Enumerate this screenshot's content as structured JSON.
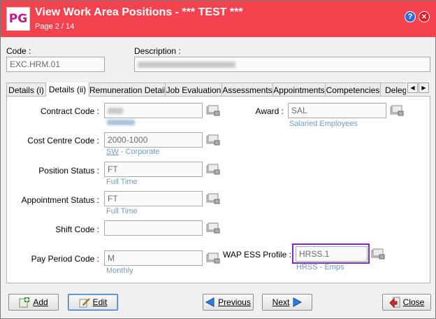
{
  "window": {
    "logo": "PG",
    "title": "View Work Area Positions - *** TEST ***",
    "subtitle": "Page 2 / 14",
    "help_glyph": "?",
    "close_glyph": "✕"
  },
  "header": {
    "code_label": "Code :",
    "code_value": "EXC.HRM.01",
    "description_label": "Description :"
  },
  "tabs": [
    {
      "label": "Details (i)"
    },
    {
      "label": "Details (ii)"
    },
    {
      "label": "Remuneration Details"
    },
    {
      "label": "Job Evaluation"
    },
    {
      "label": "Assessments"
    },
    {
      "label": "Appointments"
    },
    {
      "label": "Competencies"
    },
    {
      "label": "Delega"
    }
  ],
  "form": {
    "contract_code_label": "Contract Code :",
    "cost_centre_label": "Cost Centre Code :",
    "cost_centre_value": "2000-1000",
    "cost_centre_desc_code": "SW",
    "cost_centre_desc": " - Corporate",
    "position_status_label": "Position Status :",
    "position_status_value": "FT",
    "position_status_desc": "Full Time",
    "appointment_status_label": "Appointment Status :",
    "appointment_status_value": "FT",
    "appointment_status_desc": "Full Time",
    "shift_code_label": "Shift Code :",
    "pay_period_label": "Pay Period Code :",
    "pay_period_value": "M",
    "pay_period_desc": "Monthly",
    "award_label": "Award :",
    "award_value": "SAL",
    "award_desc": "Salaried Employees",
    "wap_label": "WAP ESS Profile :",
    "wap_value": "HRSS.1",
    "wap_desc": "HRSS - Emps"
  },
  "buttons": {
    "add": "Add",
    "edit": "Edit",
    "previous": "Previous",
    "next": "Next",
    "close": "Close"
  },
  "colors": {
    "titlebar": "#f4434f",
    "highlight": "#7a2ad2",
    "link_text": "#6f9bc6"
  }
}
